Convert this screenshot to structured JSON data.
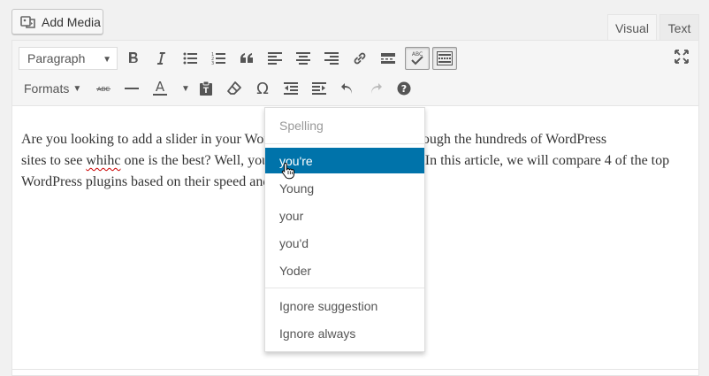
{
  "media": {
    "add_media_label": "Add Media"
  },
  "tabs": {
    "visual": "Visual",
    "text": "Text"
  },
  "toolbar": {
    "row1": {
      "paragraph_select": "Paragraph",
      "icons": [
        "bold-icon",
        "italic-icon",
        "bulleted-list-icon",
        "numbered-list-icon",
        "blockquote-icon",
        "align-left-icon",
        "align-center-icon",
        "align-right-icon",
        "link-icon",
        "read-more-icon",
        "spellcheck-icon",
        "toolbar-toggle-icon",
        "fullscreen-icon"
      ]
    },
    "row2": {
      "formats_label": "Formats",
      "icons": [
        "strikethrough-icon",
        "horizontal-line-icon",
        "text-color-icon",
        "paste-text-icon",
        "clear-formatting-icon",
        "special-character-icon",
        "decrease-indent-icon",
        "increase-indent-icon",
        "undo-icon",
        "redo-icon",
        "help-icon"
      ]
    },
    "abc_label": "ABC",
    "text_color_letter": "A",
    "omega": "Ω",
    "help_q": "?"
  },
  "content": {
    "line1": "Are you looking to add a slider in your WordPress site? After going through the hundreds of WordPress",
    "line2_before": "sites to see ",
    "line2_misspelled": "whihc",
    "line2_after": " one is the best? Well, you've come to the right place. In this article, we will compare 4 of the top",
    "line3": "WordPress plugins based on their speed and performance."
  },
  "spell_menu": {
    "header": "Spelling",
    "suggestions": [
      "you're",
      "Young",
      "your",
      "you'd",
      "Yoder"
    ],
    "actions": [
      "Ignore suggestion",
      "Ignore always"
    ]
  },
  "colors": {
    "accent": "#0073aa",
    "misspell": "#cc0000"
  }
}
